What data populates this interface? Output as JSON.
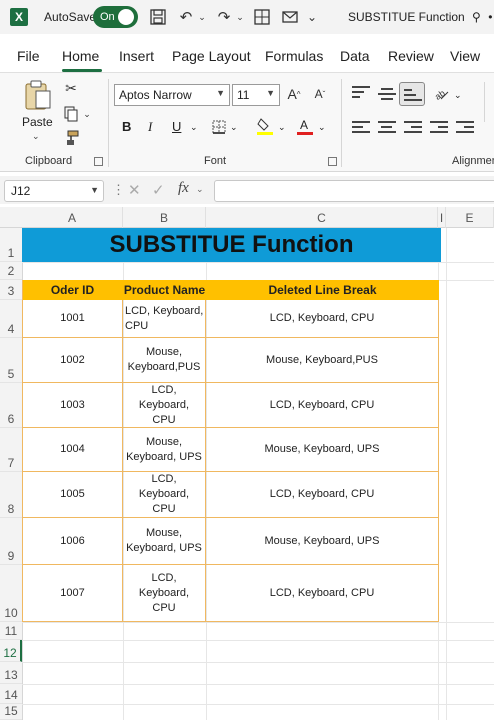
{
  "titlebar": {
    "autosave_label": "AutoSave",
    "toggle_label": "On",
    "doc_title": "SUBSTITUE Function",
    "doc_title_suffix": "• S"
  },
  "tabs": [
    "File",
    "Home",
    "Insert",
    "Page Layout",
    "Formulas",
    "Data",
    "Review",
    "View"
  ],
  "ribbon": {
    "paste_label": "Paste",
    "clipboard_label": "Clipboard",
    "font_name": "Aptos Narrow",
    "font_size": "11",
    "font_label": "Font",
    "alignment_label": "Alignmen",
    "bold": "B",
    "italic": "I",
    "underline": "U"
  },
  "formula_bar": {
    "name_box": "J12",
    "fx": "fx",
    "formula": ""
  },
  "columns": [
    "A",
    "B",
    "C",
    "I",
    "E"
  ],
  "rows": [
    "1",
    "2",
    "3",
    "4",
    "5",
    "6",
    "7",
    "8",
    "9",
    "10",
    "11",
    "12",
    "13",
    "14",
    "15"
  ],
  "sheet": {
    "title": "SUBSTITUE Function",
    "headers": [
      "Oder ID",
      "Product Name",
      "Deleted Line Break"
    ],
    "data": [
      {
        "id": "1001",
        "product": "LCD, Keyboard, CPU",
        "deleted": "LCD, Keyboard, CPU"
      },
      {
        "id": "1002",
        "product": "Mouse, Keyboard,PUS",
        "deleted": "Mouse, Keyboard,PUS"
      },
      {
        "id": "1003",
        "product": "LCD, Keyboard, CPU",
        "deleted": "LCD, Keyboard, CPU"
      },
      {
        "id": "1004",
        "product": "Mouse, Keyboard, UPS",
        "deleted": "Mouse, Keyboard, UPS"
      },
      {
        "id": "1005",
        "product": "LCD, Keyboard, CPU",
        "deleted": "LCD, Keyboard, CPU"
      },
      {
        "id": "1006",
        "product": "Mouse, Keyboard, UPS",
        "deleted": "Mouse, Keyboard, UPS"
      },
      {
        "id": "1007",
        "product": "LCD, Keyboard, CPU",
        "deleted": "LCD, Keyboard, CPU"
      }
    ]
  },
  "colors": {
    "title_fill": "#0f9bd7",
    "header_fill": "#ffc000",
    "border": "#f0b860",
    "excel_green": "#1d6f42"
  }
}
